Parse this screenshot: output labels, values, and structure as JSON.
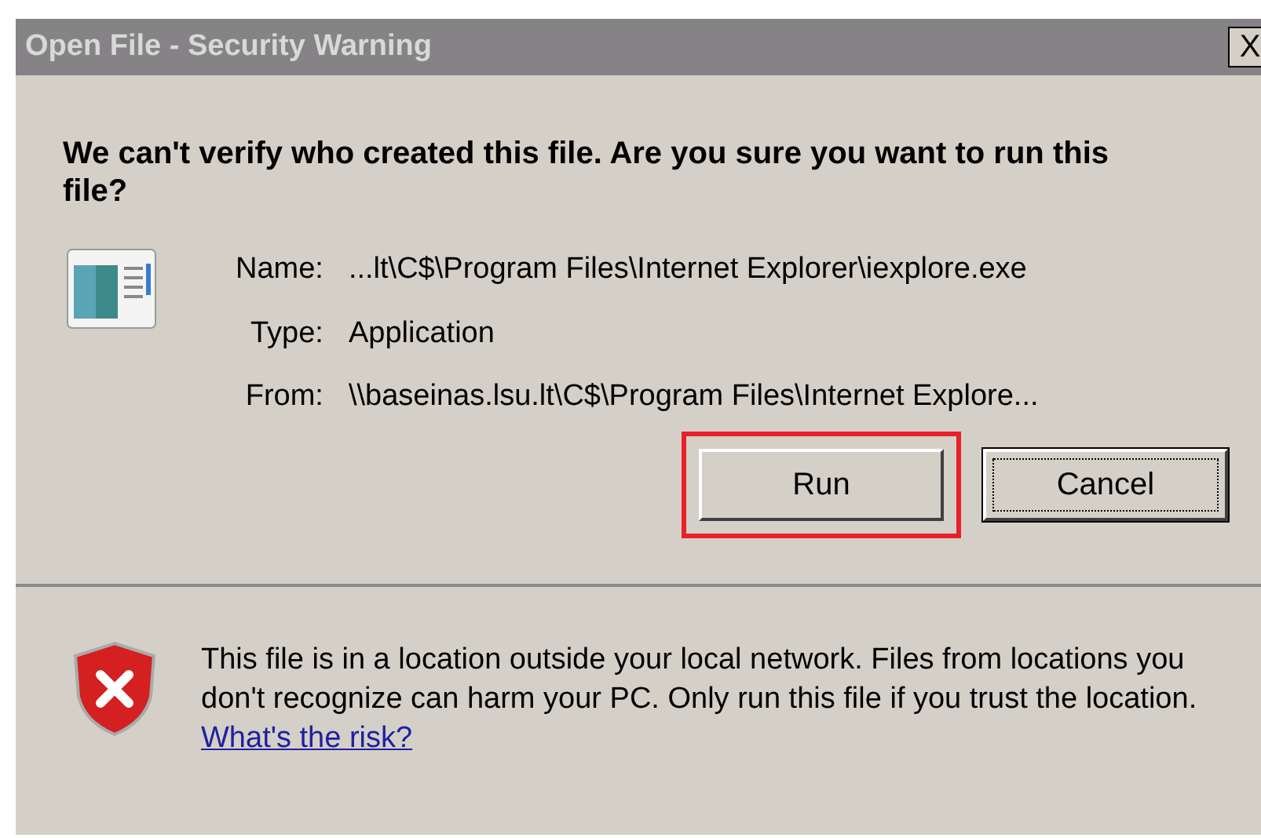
{
  "window": {
    "title": "Open File - Security Warning",
    "close": "X"
  },
  "heading": "We can't verify who created this file. Are you sure you want to run this file?",
  "fields": [
    {
      "label": "Name:",
      "value": "...lt\\C$\\Program Files\\Internet Explorer\\iexplore.exe"
    },
    {
      "label": "Type:",
      "value": "Application"
    },
    {
      "label": "From:",
      "value": "\\\\baseinas.lsu.lt\\C$\\Program Files\\Internet Explore..."
    }
  ],
  "buttons": [
    {
      "label": "Run",
      "highlighted": true,
      "focused": false
    },
    {
      "label": "Cancel",
      "highlighted": false,
      "focused": true
    }
  ],
  "warning": {
    "text": "This file is in a location outside your local network. Files from locations you don't recognize can harm your PC. Only run this file if you trust the location.",
    "link": "What's the risk?"
  }
}
